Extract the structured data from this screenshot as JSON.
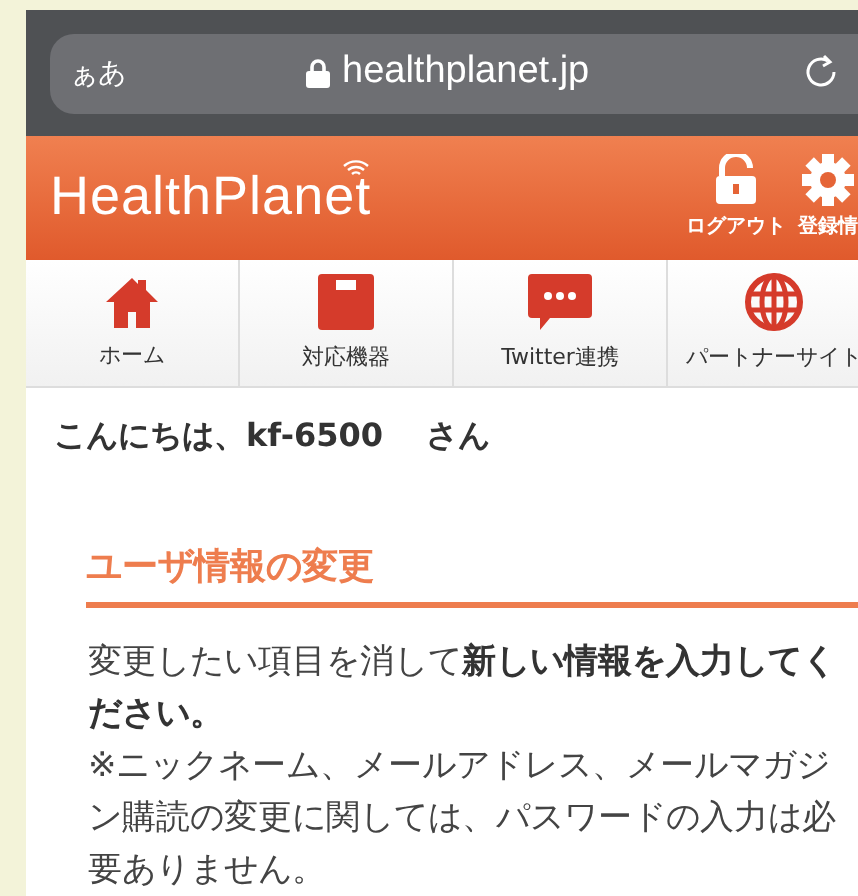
{
  "browser": {
    "text_size_button": "ぁあ",
    "url": "healthplanet.jp"
  },
  "header": {
    "logo": "HealthPlanet",
    "actions": [
      {
        "kind": "lock",
        "label": "ログアウト"
      },
      {
        "kind": "gear",
        "label": "登録情"
      }
    ]
  },
  "nav": [
    {
      "kind": "home",
      "label": "ホーム"
    },
    {
      "kind": "scale",
      "label": "対応機器"
    },
    {
      "kind": "chat",
      "label": "Twitter連携"
    },
    {
      "kind": "globe",
      "label": "パートナーサイト"
    }
  ],
  "greeting": "こんにちは、kf-6500　 さん",
  "section": {
    "title": "ユーザ情報の変更",
    "paragraphs": [
      "変更したい項目を消して**新しい情報を入力してください。**",
      "※ニックネーム、メールアドレス、メールマガジン購読の変更に関しては、パスワードの入力は必要ありません。"
    ]
  }
}
